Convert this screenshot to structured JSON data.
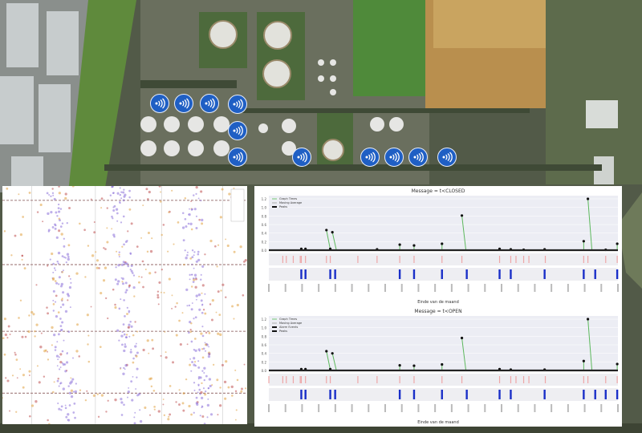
{
  "sensors": {
    "icon": "wifi-icon",
    "color": "#1f5fc4",
    "count": 11
  },
  "chart_data": [
    {
      "type": "scatter",
      "title": "",
      "note": "dense event scatter, cluster bands",
      "band_centers_x": [
        22,
        48,
        77
      ],
      "row_lines_y": [
        6,
        33,
        61,
        87
      ],
      "colors": [
        "#8a6fd8",
        "#e0a040",
        "#c05050"
      ],
      "xlim": [
        0,
        100
      ],
      "ylim": [
        0,
        100
      ]
    },
    {
      "type": "line",
      "title": "Message = t<CLOSED",
      "xlabel": "Einde van de maand",
      "ylabel": "",
      "ylim": [
        0,
        1.2
      ],
      "yticks": [
        "0.0",
        "0.2",
        "0.4",
        "0.6",
        "0.8",
        "1.0",
        "1.2"
      ],
      "legend": [
        "Graph Times",
        "Moving Average",
        "Peaks"
      ],
      "legend_position": "top-left",
      "xlim": [
        0,
        100
      ],
      "peaks": [
        {
          "x": 9.3,
          "y": 0.03
        },
        {
          "x": 10.5,
          "y": 0.03
        },
        {
          "x": 16.5,
          "y": 0.47
        },
        {
          "x": 17.6,
          "y": 0.03
        },
        {
          "x": 18.2,
          "y": 0.42
        },
        {
          "x": 31,
          "y": 0.02
        },
        {
          "x": 37.5,
          "y": 0.13
        },
        {
          "x": 41.6,
          "y": 0.11
        },
        {
          "x": 49.6,
          "y": 0.15
        },
        {
          "x": 55.3,
          "y": 0.81
        },
        {
          "x": 66.1,
          "y": 0.03
        },
        {
          "x": 69.3,
          "y": 0.02
        },
        {
          "x": 73,
          "y": 0.01
        },
        {
          "x": 79,
          "y": 0.02
        },
        {
          "x": 90.2,
          "y": 0.21
        },
        {
          "x": 91.4,
          "y": 1.2
        },
        {
          "x": 96.5,
          "y": 0.01
        },
        {
          "x": 99.8,
          "y": 0.15
        }
      ],
      "red_events": [
        4,
        5,
        7,
        9,
        9.3,
        10.5,
        16.5,
        17.6,
        25.5,
        31,
        37.5,
        41.6,
        49.6,
        55.3,
        66.1,
        69.3,
        70.8,
        73,
        74.5,
        79.2,
        90.2,
        91.4,
        96.5,
        99.8
      ],
      "blue_events": [
        9.3,
        10.5,
        17.6,
        19,
        37.5,
        41.6,
        49.6,
        56.7,
        66.1,
        69.3,
        79,
        90.2,
        93.5,
        99.8
      ]
    },
    {
      "type": "line",
      "title": "Message = t<OPEN",
      "xlabel": "Einde van de maand",
      "ylabel": "",
      "ylim": [
        0,
        1.2
      ],
      "yticks": [
        "0.0",
        "0.2",
        "0.4",
        "0.6",
        "0.8",
        "1.0",
        "1.2"
      ],
      "legend": [
        "Graph Times",
        "Moving Average",
        "Alarm Events",
        "Peaks"
      ],
      "legend_position": "top-left",
      "xlim": [
        0,
        100
      ],
      "peaks": [
        {
          "x": 9.3,
          "y": 0.03
        },
        {
          "x": 10.5,
          "y": 0.03
        },
        {
          "x": 16.5,
          "y": 0.45
        },
        {
          "x": 17.6,
          "y": 0.03
        },
        {
          "x": 18.2,
          "y": 0.4
        },
        {
          "x": 37.5,
          "y": 0.12
        },
        {
          "x": 41.6,
          "y": 0.11
        },
        {
          "x": 49.6,
          "y": 0.14
        },
        {
          "x": 55.3,
          "y": 0.76
        },
        {
          "x": 66.1,
          "y": 0.03
        },
        {
          "x": 69.3,
          "y": 0.02
        },
        {
          "x": 79,
          "y": 0.02
        },
        {
          "x": 90.2,
          "y": 0.22
        },
        {
          "x": 91.4,
          "y": 1.2
        },
        {
          "x": 99.8,
          "y": 0.15
        }
      ],
      "red_events": [
        0,
        4,
        5,
        7,
        9,
        9.3,
        10.5,
        16.5,
        17.6,
        25.5,
        31,
        37.5,
        41.6,
        49.6,
        55.3,
        66.1,
        69.3,
        70.8,
        73,
        74.5,
        79.2,
        90.2,
        91.4,
        96.5,
        99.8
      ],
      "blue_events": [
        9.3,
        10.5,
        17.6,
        19,
        37.5,
        41.6,
        49.6,
        56.7,
        66.1,
        69.3,
        79,
        90.2,
        93.5,
        96.5,
        99.8
      ]
    }
  ]
}
